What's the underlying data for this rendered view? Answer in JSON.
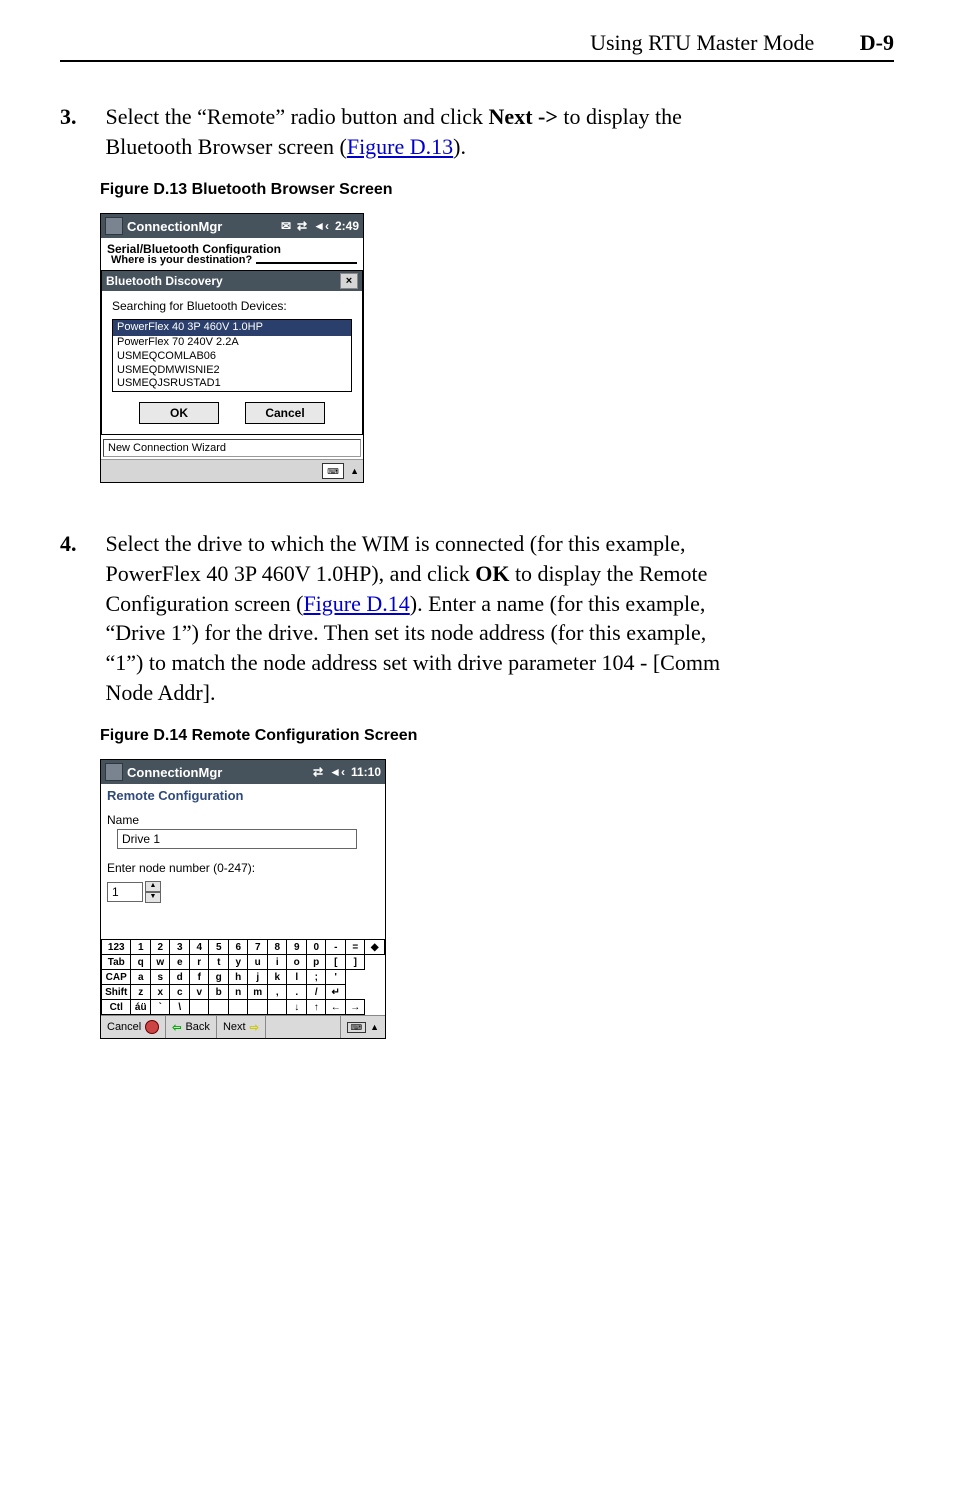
{
  "header": {
    "title": "Using RTU Master Mode",
    "page": "D-9"
  },
  "step3": {
    "num": "3.",
    "text_a": "Select the “Remote” radio button and click ",
    "bold": "Next ->",
    "text_b": " to display the Bluetooth Browser screen (",
    "link": "Figure D.13",
    "text_c": ")."
  },
  "fig13": {
    "caption": "Figure D.13   Bluetooth Browser Screen"
  },
  "bt": {
    "app": "ConnectionMgr",
    "time": "2:49",
    "sound": "◄‹",
    "subtitle": "Serial/Bluetooth Configuration",
    "group": "Where is your destination?",
    "dlg_title": "Bluetooth Discovery",
    "search": "Searching for Bluetooth Devices:",
    "devices": [
      "PowerFlex 40 3P 460V  1.0HP",
      "PowerFlex 70 240V    2.2A",
      "USMEQCOMLAB06",
      "USMEQDMWISNIE2",
      "USMEQJSRUSTAD1"
    ],
    "ok": "OK",
    "cancel": "Cancel",
    "status": "New Connection Wizard"
  },
  "step4": {
    "num": "4.",
    "text_a": "Select the drive to which the WIM is connected (for this example, PowerFlex 40 3P 460V 1.0HP), and click ",
    "bold1": "OK",
    "text_b": " to display the Remote Configuration screen (",
    "link": "Figure D.14",
    "text_c": "). Enter a name (for this example, “Drive 1”) for the drive. Then set its node address (for this example, “1”) to match the node address set with drive parameter 104 - [Comm Node Addr]."
  },
  "fig14": {
    "caption": "Figure D.14   Remote Configuration Screen"
  },
  "rc": {
    "app": "ConnectionMgr",
    "time": "11:10",
    "subtitle": "Remote Configuration",
    "name_label": "Name",
    "name_value": "Drive 1",
    "node_label": "Enter node number (0-247):",
    "node_value": "1",
    "kb_rows": [
      [
        "123",
        "1",
        "2",
        "3",
        "4",
        "5",
        "6",
        "7",
        "8",
        "9",
        "0",
        "-",
        "=",
        "◆"
      ],
      [
        "Tab",
        "q",
        "w",
        "e",
        "r",
        "t",
        "y",
        "u",
        "i",
        "o",
        "p",
        "[",
        "]"
      ],
      [
        "CAP",
        "a",
        "s",
        "d",
        "f",
        "g",
        "h",
        "j",
        "k",
        "l",
        ";",
        "'"
      ],
      [
        "Shift",
        "z",
        "x",
        "c",
        "v",
        "b",
        "n",
        "m",
        ",",
        ".",
        "/",
        "↵"
      ],
      [
        "Ctl",
        "áü",
        "`",
        "\\",
        "",
        "",
        "",
        "",
        "",
        "↓",
        "↑",
        "←",
        "→"
      ]
    ],
    "cancel": "Cancel",
    "back": "Back",
    "next": "Next"
  }
}
